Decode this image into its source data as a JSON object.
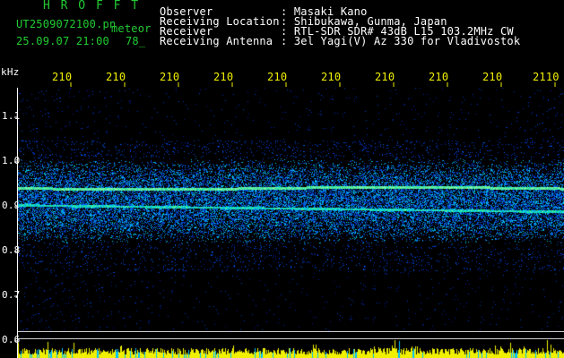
{
  "header": {
    "brand": "H R O F F T",
    "filename": "UT2509072100.pn",
    "filename_suffix": "meteor",
    "datetime": "25.09.07 21:00",
    "count": "78_",
    "info_labels": [
      "Observer",
      "Receiving Location",
      "Receiver",
      "Receiving Antenna"
    ],
    "info_values": [
      ": Masaki Kano",
      ": Shibukawa, Gunma, Japan",
      ": RTL-SDR SDR# 43dB L15 103.2MHz CW",
      ": 3el Yagi(V) Az 330 for Vladivostok"
    ]
  },
  "axis": {
    "unit_label": "kHz",
    "y_ticks": [
      "1.1",
      "1.0",
      "0.9",
      "0.8",
      "0.7",
      "0.6"
    ],
    "time_labels": [
      "210",
      "210",
      "210",
      "210",
      "210",
      "210",
      "210",
      "210",
      "210",
      "2110"
    ]
  },
  "colors": {
    "background": "#000000",
    "axis": "#ffffff",
    "brand": "#22cc33",
    "time_label": "#f0f000",
    "signal_low": "#0020a0",
    "signal_high": "#90ff90",
    "power_bar": "#f0f000",
    "power_bar_alt": "#00c0ff"
  }
}
